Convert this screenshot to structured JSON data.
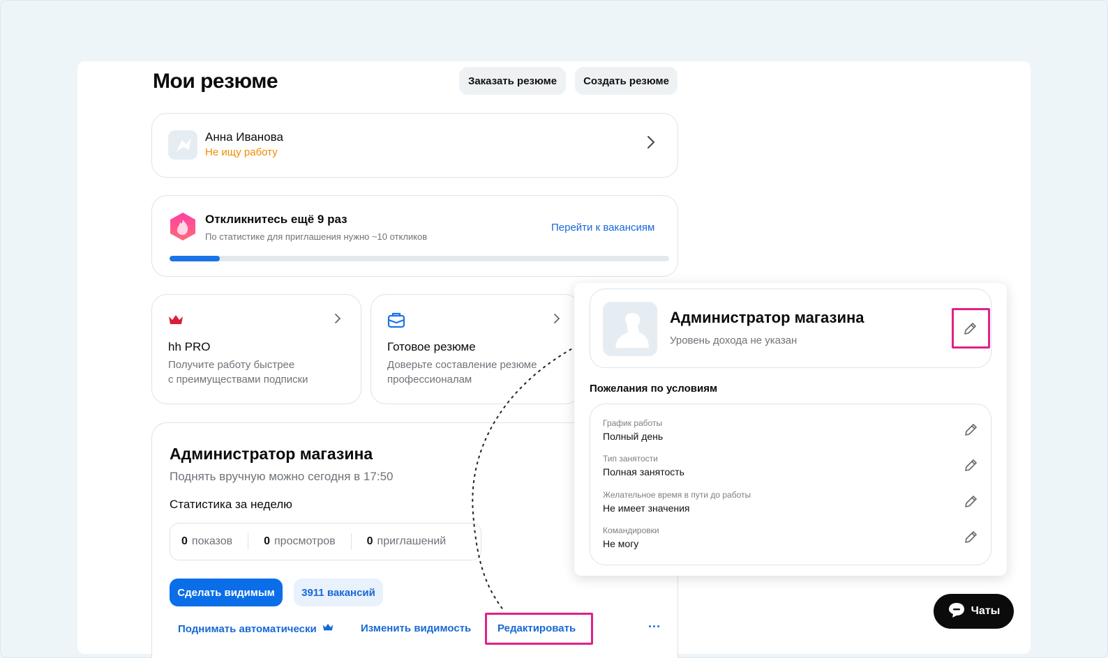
{
  "header": {
    "title": "Мои резюме",
    "order_button": "Заказать резюме",
    "create_button": "Создать резюме"
  },
  "profile": {
    "name": "Анна Иванова",
    "status": "Не ищу работу"
  },
  "responses": {
    "title": "Откликнитесь ещё 9 раз",
    "subtitle": "По статистике для приглашения нужно ~10 откликов",
    "link": "Перейти к вакансиям",
    "progress": 0.1
  },
  "promo": [
    {
      "title": "hh PRO",
      "line1": "Получите работу быстрее",
      "line2": "с преимуществами подписки"
    },
    {
      "title": "Готовое резюме",
      "line1": "Доверьте составление резюме",
      "line2": "профессионалам"
    }
  ],
  "resume": {
    "title": "Администратор магазина",
    "raise_info": "Поднять вручную можно сегодня в 17:50",
    "stats_title": "Статистика за неделю",
    "stats": [
      {
        "value": "0",
        "label": "показов"
      },
      {
        "value": "0",
        "label": "просмотров"
      },
      {
        "value": "0",
        "label": "приглашений"
      }
    ],
    "make_visible": "Сделать видимым",
    "vacancies": "3911 вакансий",
    "actions": {
      "auto_raise": "Поднимать автоматически",
      "change_visibility": "Изменить видимость",
      "edit": "Редактировать",
      "more": "···"
    }
  },
  "popup": {
    "title": "Администратор магазина",
    "salary": "Уровень дохода не указан",
    "conditions_title": "Пожелания по условиям",
    "conditions": [
      {
        "label": "График работы",
        "value": "Полный день"
      },
      {
        "label": "Тип занятости",
        "value": "Полная занятость"
      },
      {
        "label": "Желательное время в пути до работы",
        "value": "Не имеет значения"
      },
      {
        "label": "Командировки",
        "value": "Не могу"
      }
    ]
  },
  "chat": {
    "label": "Чаты"
  },
  "colors": {
    "accent": "#0a6ee8",
    "highlight": "#e0218a",
    "status_orange": "#f08c00"
  }
}
